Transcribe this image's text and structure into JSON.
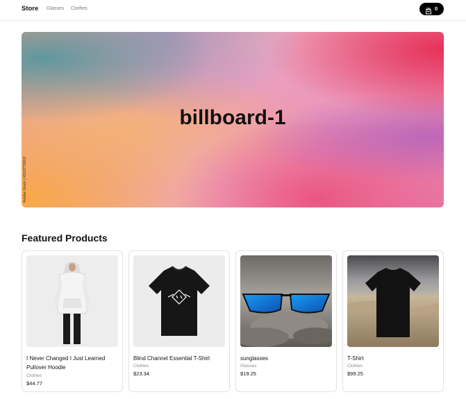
{
  "navbar": {
    "brand": "Store",
    "links": [
      "Glasses",
      "Clothes"
    ],
    "cart": {
      "icon": "shopping-bag-icon",
      "count": "0"
    }
  },
  "billboard": {
    "label": "billboard-1",
    "image_caption": "Adobe Stock | #610775819"
  },
  "featured": {
    "title": "Featured Products",
    "products": [
      {
        "name": "I Never Changed I Just Learned Pullover Hoodie",
        "category": "Clothes",
        "price": "$44.77"
      },
      {
        "name": "Blind Channel Essential T-Shirt",
        "category": "Clothes",
        "price": "$23.34"
      },
      {
        "name": "sunglasses",
        "category": "Glasses",
        "price": "$19.25"
      },
      {
        "name": "T-Shirt",
        "category": "Clothes",
        "price": "$99.25"
      }
    ]
  }
}
